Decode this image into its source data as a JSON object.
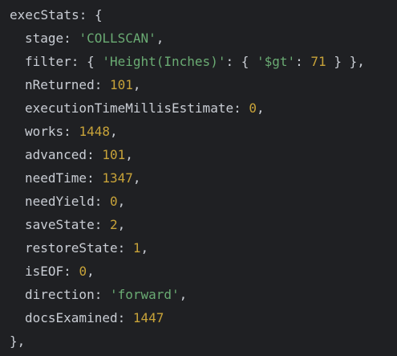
{
  "code": {
    "open": {
      "key": "execStats",
      "sep": ": ",
      "brace": "{"
    },
    "fields": {
      "stage": {
        "key": "stage",
        "value": "'COLLSCAN'",
        "type": "string",
        "comma": ","
      },
      "filter": {
        "key": "filter",
        "open": "{ ",
        "inner_key": "'Height(Inches)'",
        "inner_sep": ": { ",
        "op": "'$gt'",
        "op_sep": ": ",
        "value": "71",
        "close": " } },",
        "type": "object"
      },
      "nReturned": {
        "key": "nReturned",
        "value": "101",
        "type": "number",
        "comma": ","
      },
      "executionTimeMillisEstimate": {
        "key": "executionTimeMillisEstimate",
        "value": "0",
        "type": "number",
        "comma": ","
      },
      "works": {
        "key": "works",
        "value": "1448",
        "type": "number",
        "comma": ","
      },
      "advanced": {
        "key": "advanced",
        "value": "101",
        "type": "number",
        "comma": ","
      },
      "needTime": {
        "key": "needTime",
        "value": "1347",
        "type": "number",
        "comma": ","
      },
      "needYield": {
        "key": "needYield",
        "value": "0",
        "type": "number",
        "comma": ","
      },
      "saveState": {
        "key": "saveState",
        "value": "2",
        "type": "number",
        "comma": ","
      },
      "restoreState": {
        "key": "restoreState",
        "value": "1",
        "type": "number",
        "comma": ","
      },
      "isEOF": {
        "key": "isEOF",
        "value": "0",
        "type": "number",
        "comma": ","
      },
      "direction": {
        "key": "direction",
        "value": "'forward'",
        "type": "string",
        "comma": ","
      },
      "docsExamined": {
        "key": "docsExamined",
        "value": "1447",
        "type": "number",
        "comma": ""
      }
    },
    "close": "},",
    "sep": ": "
  },
  "colors": {
    "background": "#1f2023",
    "text": "#c9cdd4",
    "string": "#6aab73",
    "number": "#c8a339"
  }
}
